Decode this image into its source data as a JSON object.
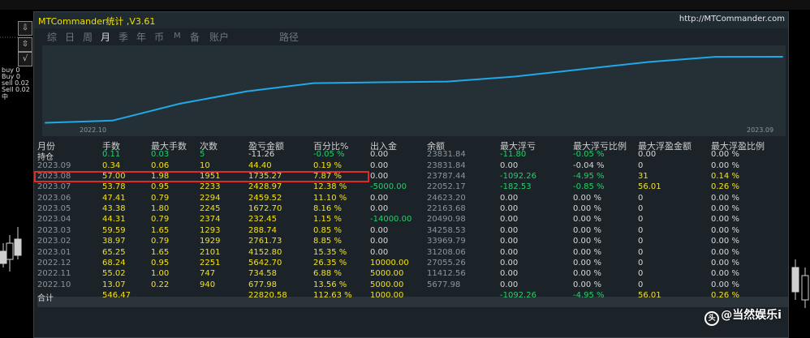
{
  "window": {
    "title": "MTCommander统计 ,V3.61",
    "url": "http://MTCommander.com"
  },
  "tabs": [
    "综",
    "日",
    "周",
    "月",
    "季",
    "年",
    "币",
    "M",
    "备",
    "账户",
    "路径"
  ],
  "active_tab": "月",
  "left_toolbar": {
    "buttons": [
      "⇩",
      "⇳",
      "√"
    ],
    "labels": [
      "buy 0",
      "Buy 0",
      "sell 0.02",
      "Sell 0.02",
      "中"
    ]
  },
  "chart_data": {
    "type": "line",
    "x": [
      "2022.10",
      "2022.11",
      "2022.12",
      "2023.01",
      "2023.02",
      "2023.03",
      "2023.04",
      "2023.05",
      "2023.06",
      "2023.07",
      "2023.08",
      "2023.09"
    ],
    "values": [
      677.98,
      1412.56,
      7055.26,
      11208.06,
      13969.79,
      14258.53,
      14490.98,
      16163.68,
      18623.2,
      21052.17,
      22787.44,
      22820.58
    ],
    "x_start_label": "2022.10",
    "x_end_label": "2023.09",
    "color": "#1fa9e6"
  },
  "table": {
    "headers": [
      "月份",
      "手数",
      "最大手数",
      "次数",
      "盈亏金额",
      "百分比%",
      "出入金",
      "余额",
      "最大浮亏",
      "最大浮亏比例",
      "最大浮盈金额",
      "最大浮盈比例"
    ],
    "rows": [
      {
        "cells": [
          "持仓",
          "0.11",
          "0.03",
          "5",
          "-11.26",
          "-0.05 %",
          "0.00",
          "23831.84",
          "-11.80",
          "-0.05 %",
          "0.00",
          "0.00 %"
        ],
        "colors": [
          "w",
          "g",
          "g",
          "g",
          "w",
          "g",
          "w",
          "gy",
          "g",
          "g",
          "w",
          "w"
        ]
      },
      {
        "cells": [
          "2023.09",
          "0.34",
          "0.06",
          "10",
          "44.40",
          "0.19 %",
          "0.00",
          "23831.84",
          "0.00",
          "-0.04 %",
          "0",
          "0.00 %"
        ],
        "colors": [
          "gy",
          "y",
          "y",
          "y",
          "y",
          "y",
          "w",
          "gy",
          "w",
          "w",
          "w",
          "w"
        ]
      },
      {
        "cells": [
          "2023.08",
          "57.00",
          "1.98",
          "1951",
          "1735.27",
          "7.87 %",
          "0.00",
          "23787.44",
          "-1092.26",
          "-4.95 %",
          "31",
          "0.14 %"
        ],
        "colors": [
          "gy",
          "y",
          "y",
          "y",
          "y",
          "y",
          "w",
          "gy",
          "g",
          "g",
          "y",
          "y"
        ]
      },
      {
        "cells": [
          "2023.07",
          "53.78",
          "0.95",
          "2233",
          "2428.97",
          "12.38 %",
          "-5000.00",
          "22052.17",
          "-182.53",
          "-0.85 %",
          "56.01",
          "0.26 %"
        ],
        "colors": [
          "gy",
          "y",
          "y",
          "y",
          "y",
          "y",
          "g",
          "gy",
          "g",
          "g",
          "y",
          "y"
        ]
      },
      {
        "cells": [
          "2023.06",
          "47.41",
          "0.79",
          "2294",
          "2459.52",
          "11.10 %",
          "0.00",
          "24623.20",
          "0.00",
          "0.00 %",
          "0",
          "0.00 %"
        ],
        "colors": [
          "gy",
          "y",
          "y",
          "y",
          "y",
          "y",
          "w",
          "gy",
          "w",
          "w",
          "w",
          "w"
        ]
      },
      {
        "cells": [
          "2023.05",
          "43.38",
          "1.80",
          "2245",
          "1672.70",
          "8.16 %",
          "0.00",
          "22163.68",
          "0.00",
          "0.00 %",
          "0",
          "0.00 %"
        ],
        "colors": [
          "gy",
          "y",
          "y",
          "y",
          "y",
          "y",
          "w",
          "gy",
          "w",
          "w",
          "w",
          "w"
        ]
      },
      {
        "cells": [
          "2023.04",
          "44.31",
          "0.79",
          "2374",
          "232.45",
          "1.15 %",
          "-14000.00",
          "20490.98",
          "0.00",
          "0.00 %",
          "0",
          "0.00 %"
        ],
        "colors": [
          "gy",
          "y",
          "y",
          "y",
          "y",
          "y",
          "g",
          "gy",
          "w",
          "w",
          "w",
          "w"
        ]
      },
      {
        "cells": [
          "2023.03",
          "59.59",
          "1.65",
          "1293",
          "288.74",
          "0.85 %",
          "0.00",
          "34258.53",
          "0.00",
          "0.00 %",
          "0",
          "0.00 %"
        ],
        "colors": [
          "gy",
          "y",
          "y",
          "y",
          "y",
          "y",
          "w",
          "gy",
          "w",
          "w",
          "w",
          "w"
        ]
      },
      {
        "cells": [
          "2023.02",
          "38.97",
          "0.79",
          "1929",
          "2761.73",
          "8.85 %",
          "0.00",
          "33969.79",
          "0.00",
          "0.00 %",
          "0",
          "0.00 %"
        ],
        "colors": [
          "gy",
          "y",
          "y",
          "y",
          "y",
          "y",
          "w",
          "gy",
          "w",
          "w",
          "w",
          "w"
        ]
      },
      {
        "cells": [
          "2023.01",
          "65.25",
          "1.65",
          "2101",
          "4152.80",
          "15.35 %",
          "0.00",
          "31208.06",
          "0.00",
          "0.00 %",
          "0",
          "0.00 %"
        ],
        "colors": [
          "gy",
          "y",
          "y",
          "y",
          "y",
          "y",
          "w",
          "gy",
          "w",
          "w",
          "w",
          "w"
        ]
      },
      {
        "cells": [
          "2022.12",
          "68.24",
          "0.95",
          "2251",
          "5642.70",
          "26.35 %",
          "10000.00",
          "27055.26",
          "0.00",
          "0.00 %",
          "0",
          "0.00 %"
        ],
        "colors": [
          "gy",
          "y",
          "y",
          "y",
          "y",
          "y",
          "y",
          "gy",
          "w",
          "w",
          "w",
          "w"
        ]
      },
      {
        "cells": [
          "2022.11",
          "55.02",
          "1.00",
          "747",
          "734.58",
          "6.88 %",
          "5000.00",
          "11412.56",
          "0.00",
          "0.00 %",
          "0",
          "0.00 %"
        ],
        "colors": [
          "gy",
          "y",
          "y",
          "y",
          "y",
          "y",
          "y",
          "gy",
          "w",
          "w",
          "w",
          "w"
        ]
      },
      {
        "cells": [
          "2022.10",
          "13.07",
          "0.22",
          "940",
          "677.98",
          "13.56 %",
          "5000.00",
          "5677.98",
          "0.00",
          "0.00 %",
          "0",
          "0.00 %"
        ],
        "colors": [
          "gy",
          "y",
          "y",
          "y",
          "y",
          "y",
          "y",
          "gy",
          "w",
          "w",
          "w",
          "w"
        ]
      }
    ],
    "total": {
      "cells": [
        "合计",
        "546.47",
        "",
        "",
        "22820.58",
        "112.63 %",
        "1000.00",
        "",
        "-1092.26",
        "-4.95 %",
        "56.01",
        "0.26 %"
      ],
      "colors": [
        "w",
        "y",
        "y",
        "y",
        "y",
        "y",
        "y",
        "gy",
        "g",
        "g",
        "y",
        "y"
      ]
    }
  },
  "watermark": {
    "icon": "toutiao-icon",
    "icon_glyph": "头",
    "text": "@当然娱乐i"
  }
}
